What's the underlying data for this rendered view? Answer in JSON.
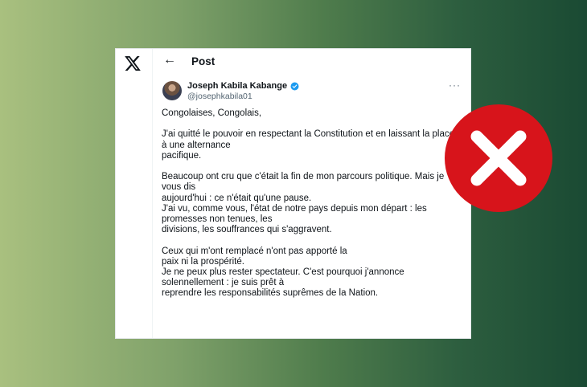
{
  "header": {
    "back_icon": "arrow-left-icon",
    "title": "Post"
  },
  "author": {
    "name": "Joseph Kabila Kabange",
    "handle": "@josephkabila01",
    "verified": true,
    "verified_color": "#1d9bf0"
  },
  "tweet": {
    "lines": [
      "Congolaises, Congolais,",
      "",
      "J'ai quitté le pouvoir en respectant la Constitution et en laissant la place",
      "à une alternance",
      "pacifique.",
      "",
      "Beaucoup ont cru que c'était la fin de mon parcours politique. Mais je",
      "vous dis",
      "aujourd'hui : ce n'était qu'une pause.",
      "J'ai vu, comme vous, l'état de notre pays depuis mon départ : les",
      "promesses non tenues, les",
      "divisions, les souffrances qui s'aggravent.",
      "",
      "Ceux qui m'ont remplacé n'ont pas apporté la",
      "paix ni la prospérité.",
      "Je ne peux plus rester spectateur. C'est pourquoi j'annonce",
      "solennellement : je suis prêt à",
      "reprendre les responsabilités suprêmes de la Nation."
    ]
  },
  "overlay": {
    "icon": "false-x-icon",
    "color": "#d7141b"
  }
}
